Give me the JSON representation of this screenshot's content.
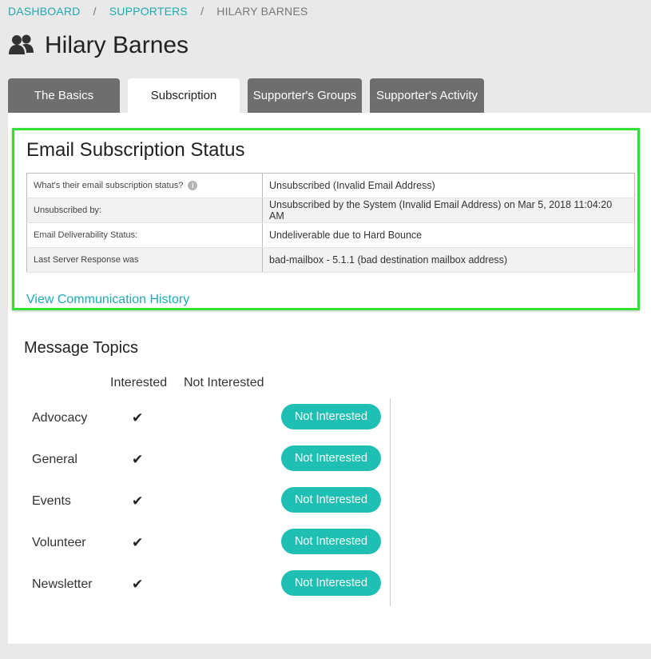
{
  "breadcrumb": {
    "items": [
      "DASHBOARD",
      "SUPPORTERS",
      "HILARY BARNES"
    ],
    "separator": "/"
  },
  "page": {
    "title": "Hilary Barnes",
    "icon": "users-icon"
  },
  "tabs": [
    {
      "label": "The Basics",
      "active": false
    },
    {
      "label": "Subscription",
      "active": true
    },
    {
      "label": "Supporter's Groups",
      "active": false
    },
    {
      "label": "Supporter's Activity",
      "active": false
    }
  ],
  "subscription": {
    "title": "Email Subscription Status",
    "rows": [
      {
        "label": "What's their email subscription status?",
        "value": "Unsubscribed (Invalid Email Address)"
      },
      {
        "label": "Unsubscribed by:",
        "value": "Unsubscribed by the System (Invalid Email Address) on Mar 5, 2018 11:04:20 AM"
      },
      {
        "label": "Email Deliverability Status:",
        "value": "Undeliverable due to Hard Bounce"
      },
      {
        "label": "Last Server Response was",
        "value": "bad-mailbox - 5.1.1 (bad destination mailbox address)"
      }
    ],
    "info_icon": "info-icon",
    "history_link": "View Communication History"
  },
  "topics": {
    "title": "Message Topics",
    "columns": [
      "Interested",
      "Not Interested"
    ],
    "check_glyph": "✔",
    "items": [
      {
        "name": "Advocacy",
        "button": "Not Interested"
      },
      {
        "name": "General",
        "button": "Not Interested"
      },
      {
        "name": "Events",
        "button": "Not Interested"
      },
      {
        "name": "Volunteer",
        "button": "Not Interested"
      },
      {
        "name": "Newsletter",
        "button": "Not Interested"
      }
    ]
  },
  "colors": {
    "accent": "#1fa9b0",
    "button": "#1fbfb3",
    "highlight": "#33e033",
    "tab_inactive": "#6e6e6e"
  }
}
